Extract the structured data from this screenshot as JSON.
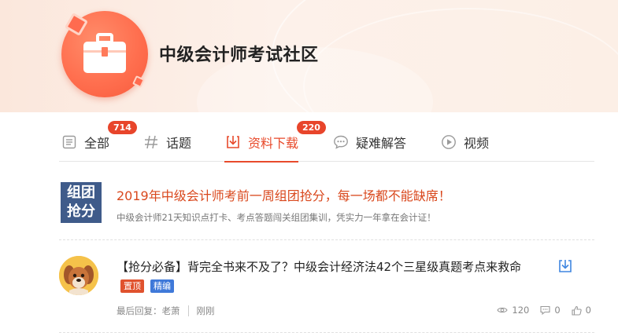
{
  "header": {
    "title": "中级会计师考试社区",
    "logo_icon": "briefcase-icon"
  },
  "tabs": [
    {
      "label": "全部",
      "icon": "list-icon",
      "badge": "714",
      "active": false
    },
    {
      "label": "话题",
      "icon": "hash-icon",
      "badge": "",
      "active": false
    },
    {
      "label": "资料下载",
      "icon": "download-icon",
      "badge": "220",
      "active": true
    },
    {
      "label": "疑难解答",
      "icon": "chat-icon",
      "badge": "",
      "active": false
    },
    {
      "label": "视频",
      "icon": "play-icon",
      "badge": "",
      "active": false
    }
  ],
  "notice": {
    "icon_line1": "组团",
    "icon_line2": "抢分",
    "title": "2019年中级会计师考前一周组团抢分，每一场都不能缺席！",
    "subtitle": "中级会计师21天知识点打卡、考点答题闯关组团集训，凭实力一年拿在会计证！"
  },
  "post": {
    "title": "【抢分必备】背完全书来不及了？中级会计经济法42个三星级真题考点来救命",
    "tag_top": "置顶",
    "tag_best": "精编",
    "last_reply": "最后回复：老萧",
    "time": "刚刚",
    "views": "120",
    "comments": "0",
    "likes": "0"
  },
  "colors": {
    "accent": "#e84a2b",
    "notice_icon_bg": "#3f5b8a",
    "tag_top": "#e0522e",
    "tag_best": "#3f79d9"
  }
}
